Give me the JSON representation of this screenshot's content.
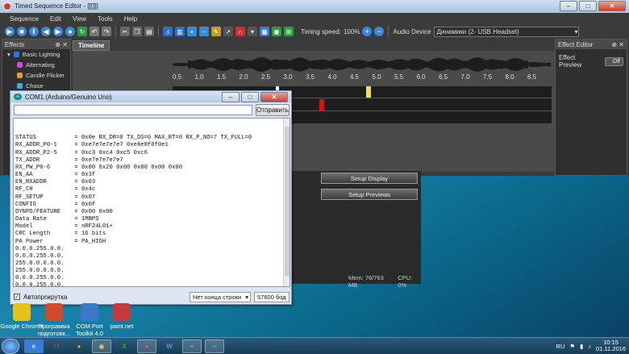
{
  "tse": {
    "title": "Timed Sequence Editor - [[[]]]",
    "menu": [
      "Sequence",
      "Edit",
      "View",
      "Tools",
      "Help"
    ],
    "timing_speed_label": "Timing speed:",
    "timing_speed_value": "100%",
    "audio_device_label": "Audio Device",
    "audio_device_value": "Динамики (2- USB Headset)",
    "effects_title": "Effects",
    "effects_items": [
      {
        "label": "Basic Lighting",
        "color": "#2a7ad6"
      },
      {
        "label": "Alternating",
        "color": "#d24ad6"
      },
      {
        "label": "Candle Flicker",
        "color": "#e0a020"
      },
      {
        "label": "Chase",
        "color": "#3ab0e0"
      }
    ],
    "timeline_tab": "Timeline",
    "ruler": [
      "0.5",
      "1.0",
      "1.5",
      "2.0",
      "2.5",
      "3.0",
      "3.5",
      "4.0",
      "4.5",
      "5.0",
      "5.5",
      "6.0",
      "6.5",
      "7.0",
      "7.5",
      "8.0",
      "8.5"
    ],
    "effect_editor_title": "Effect Editor",
    "effect_preview_label": "Effect Preview",
    "effect_preview_toggle": "Off",
    "setup_display": "Setup Display",
    "setup_previews": "Setup Previews",
    "mem": "Mem: 76/763 MB",
    "cpu": "CPU: 0%"
  },
  "serial": {
    "title": "COM1 (Arduino/Genuino Uno)",
    "send_label": "Отправить",
    "output_lines": [
      "STATUS           = 0x0e RX_DR=0 TX_DS=0 MAX_RT=0 RX_P_NO=7 TX_FULL=0",
      "RX_ADDR_P0-1     = 0xe7e7e7e7e7 0xe8e8f0f0e1",
      "RX_ADDR_P2-5     = 0xc3 0xc4 0xc5 0xc6",
      "TX_ADDR          = 0xe7e7e7e7e7",
      "RX_PW_P0-6       = 0x00 0x20 0x00 0x00 0x00 0x00",
      "EN_AA            = 0x3f",
      "EN_RXADDR        = 0x03",
      "RF_CH            = 0x4c",
      "RF_SETUP         = 0x07",
      "CONFIG           = 0x0f",
      "DYNPD/FEATURE    = 0x00 0x00",
      "Data Rate        = 1MBPS",
      "Model            = nRF24L01+",
      "CRC Length       = 16 bits",
      "PA Power         = PA_HIGH",
      "0.0.0.255.0.0.",
      "0.0.0.255.0.0.",
      "255.0.0.0.0.0.",
      "255.0.0.0.0.0.",
      "0.0.0.255.0.0.",
      "0.0.0.255.0.0."
    ],
    "autoscroll_label": "Автопрокрутка",
    "line_ending": "Нет конца строки",
    "baud": "57600 бод"
  },
  "desktop_icons": [
    {
      "label": "Google Chrome",
      "color": "#e8c21a"
    },
    {
      "label": "Программа подготовк...",
      "color": "#d24a2a"
    },
    {
      "label": "COM Port Toolkit 4.0",
      "color": "#3a78c8"
    },
    {
      "label": "paint.net",
      "color": "#c23a3a"
    }
  ],
  "taskbar": {
    "lang": "RU",
    "time": "10:15",
    "date": "01.11.2016"
  }
}
